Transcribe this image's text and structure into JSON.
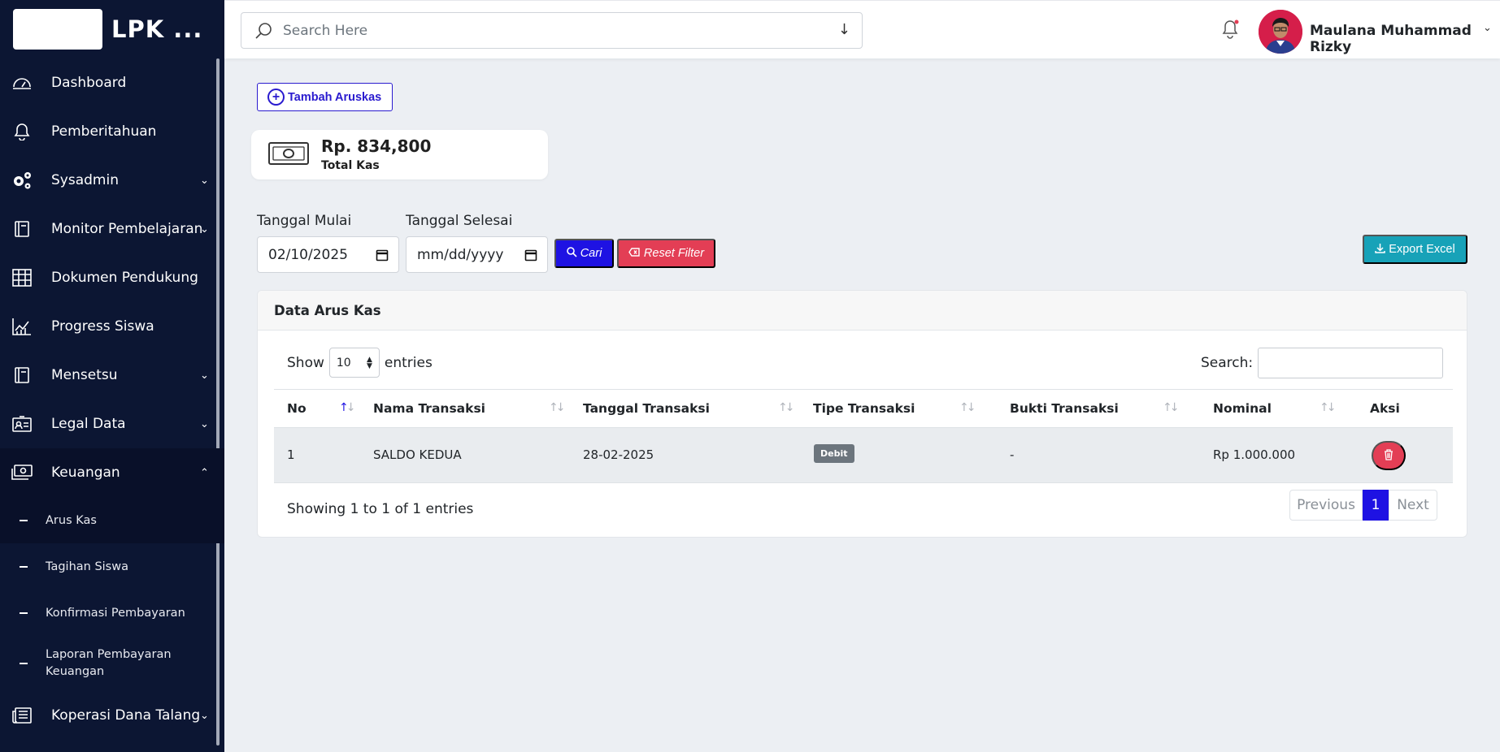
{
  "brand": {
    "name": "LPK ..."
  },
  "sidebar": {
    "items": [
      {
        "label": "Dashboard",
        "icon": "dashboard-gauge-icon",
        "has_children": false
      },
      {
        "label": "Pemberitahuan",
        "icon": "bell-icon",
        "has_children": false
      },
      {
        "label": "Sysadmin",
        "icon": "gears-icon",
        "has_children": true
      },
      {
        "label": "Monitor Pembelajaran",
        "icon": "book-icon",
        "has_children": true
      },
      {
        "label": "Dokumen Pendukung",
        "icon": "table-icon",
        "has_children": false
      },
      {
        "label": "Progress Siswa",
        "icon": "chart-line-icon",
        "has_children": false
      },
      {
        "label": "Mensetsu",
        "icon": "book-icon",
        "has_children": true
      },
      {
        "label": "Legal Data",
        "icon": "id-card-icon",
        "has_children": true
      },
      {
        "label": "Keuangan",
        "icon": "money-icon",
        "has_children": true,
        "expanded": true
      }
    ],
    "keuangan_sub": [
      {
        "label": "Arus Kas",
        "active": true
      },
      {
        "label": "Tagihan Siswa",
        "active": false
      },
      {
        "label": "Konfirmasi Pembayaran",
        "active": false
      },
      {
        "label": "Laporan Pembayaran Keuangan",
        "active": false
      }
    ],
    "last_item": {
      "label": "Koperasi Dana Talang",
      "icon": "newspaper-icon",
      "has_children": true
    }
  },
  "topbar": {
    "search_placeholder": "Search Here",
    "user_name": "Maulana Muhammad Rizky",
    "notification_dot_color": "#e33e55"
  },
  "main": {
    "add_button": "Tambah Aruskas",
    "total": {
      "amount": "Rp. 834,800",
      "label": "Total Kas"
    },
    "filter": {
      "start_label": "Tanggal Mulai",
      "start_value": "02/10/2025",
      "end_label": "Tanggal Selesai",
      "end_value": "mm/dd/yyyy",
      "search_button": "Cari",
      "reset_button": "Reset Filter"
    },
    "export_button": "Export Excel"
  },
  "table": {
    "title": "Data Arus Kas",
    "show_label": "Show",
    "entries_value": "10",
    "entries_label": "entries",
    "search_label": "Search:",
    "columns": [
      "No",
      "Nama Transaksi",
      "Tanggal Transaksi",
      "Tipe Transaksi",
      "Bukti Transaksi",
      "Nominal",
      "Aksi"
    ],
    "rows": [
      {
        "no": "1",
        "nama": "SALDO KEDUA",
        "tanggal": "28-02-2025",
        "tipe": "Debit",
        "bukti": "-",
        "nominal": "Rp 1.000.000"
      }
    ],
    "info": "Showing 1 to 1 of 1 entries",
    "pagination": {
      "previous": "Previous",
      "current": "1",
      "next": "Next"
    }
  },
  "colors": {
    "sidebar_bg": "#0c1633",
    "primary": "#1e12e3",
    "danger": "#e33e55",
    "info": "#17a2b8",
    "badge": "#6c757d"
  }
}
